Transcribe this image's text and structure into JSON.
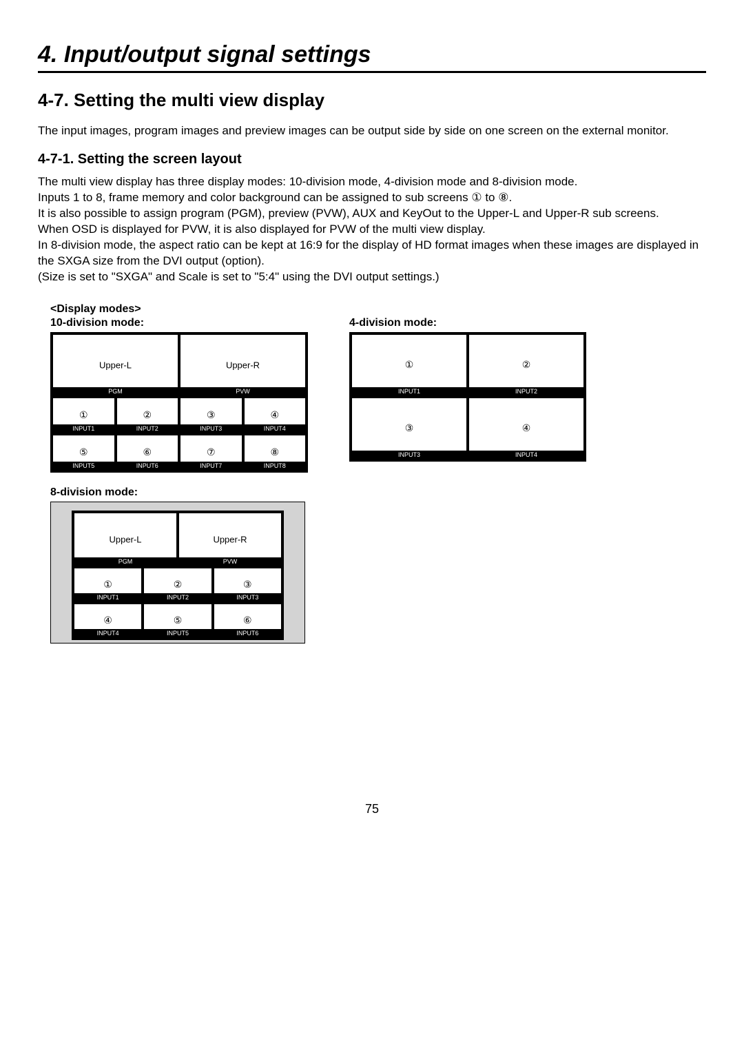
{
  "chapter": "4. Input/output signal settings",
  "section": "4-7. Setting the multi view display",
  "intro": "The input images, program images and preview images can be output side by side on one screen on the external monitor.",
  "subsection": "4-7-1. Setting the screen layout",
  "body": {
    "l1": "The multi view display has three display modes: 10-division mode, 4-division mode and 8-division mode.",
    "l2a": "Inputs 1 to 8, frame memory and color background can be assigned to sub screens ",
    "l2n1": "①",
    "l2mid": " to ",
    "l2n2": "⑧",
    "l2b": ".",
    "l3": "It is also possible to assign program (PGM), preview (PVW), AUX and KeyOut to the Upper-L and Upper-R sub screens.",
    "l4": "When OSD is displayed for PVW, it is also displayed for PVW of the multi view display.",
    "l5": "In 8-division mode, the aspect ratio can be kept at 16:9 for the display of HD format images when these images are displayed in the SXGA size from the DVI output (option).",
    "l6": "(Size is set to \"SXGA\" and Scale is set to \"5:4\" using the DVI output settings.)"
  },
  "display_modes_heading": "<Display modes>",
  "modes": {
    "ten": {
      "label": "10-division mode:",
      "upperL": "Upper-L",
      "upperR": "Upper-R",
      "pgm": "PGM",
      "pvw": "PVW",
      "cells": {
        "c1n": "①",
        "c1l": "INPUT1",
        "c2n": "②",
        "c2l": "INPUT2",
        "c3n": "③",
        "c3l": "INPUT3",
        "c4n": "④",
        "c4l": "INPUT4",
        "c5n": "⑤",
        "c5l": "INPUT5",
        "c6n": "⑥",
        "c6l": "INPUT6",
        "c7n": "⑦",
        "c7l": "INPUT7",
        "c8n": "⑧",
        "c8l": "INPUT8"
      }
    },
    "four": {
      "label": "4-division mode:",
      "cells": {
        "c1n": "①",
        "c1l": "INPUT1",
        "c2n": "②",
        "c2l": "INPUT2",
        "c3n": "③",
        "c3l": "INPUT3",
        "c4n": "④",
        "c4l": "INPUT4"
      }
    },
    "eight": {
      "label": "8-division mode:",
      "upperL": "Upper-L",
      "upperR": "Upper-R",
      "pgm": "PGM",
      "pvw": "PVW",
      "cells": {
        "c1n": "①",
        "c1l": "INPUT1",
        "c2n": "②",
        "c2l": "INPUT2",
        "c3n": "③",
        "c3l": "INPUT3",
        "c4n": "④",
        "c4l": "INPUT4",
        "c5n": "⑤",
        "c5l": "INPUT5",
        "c6n": "⑥",
        "c6l": "INPUT6"
      }
    }
  },
  "page_number": "75"
}
